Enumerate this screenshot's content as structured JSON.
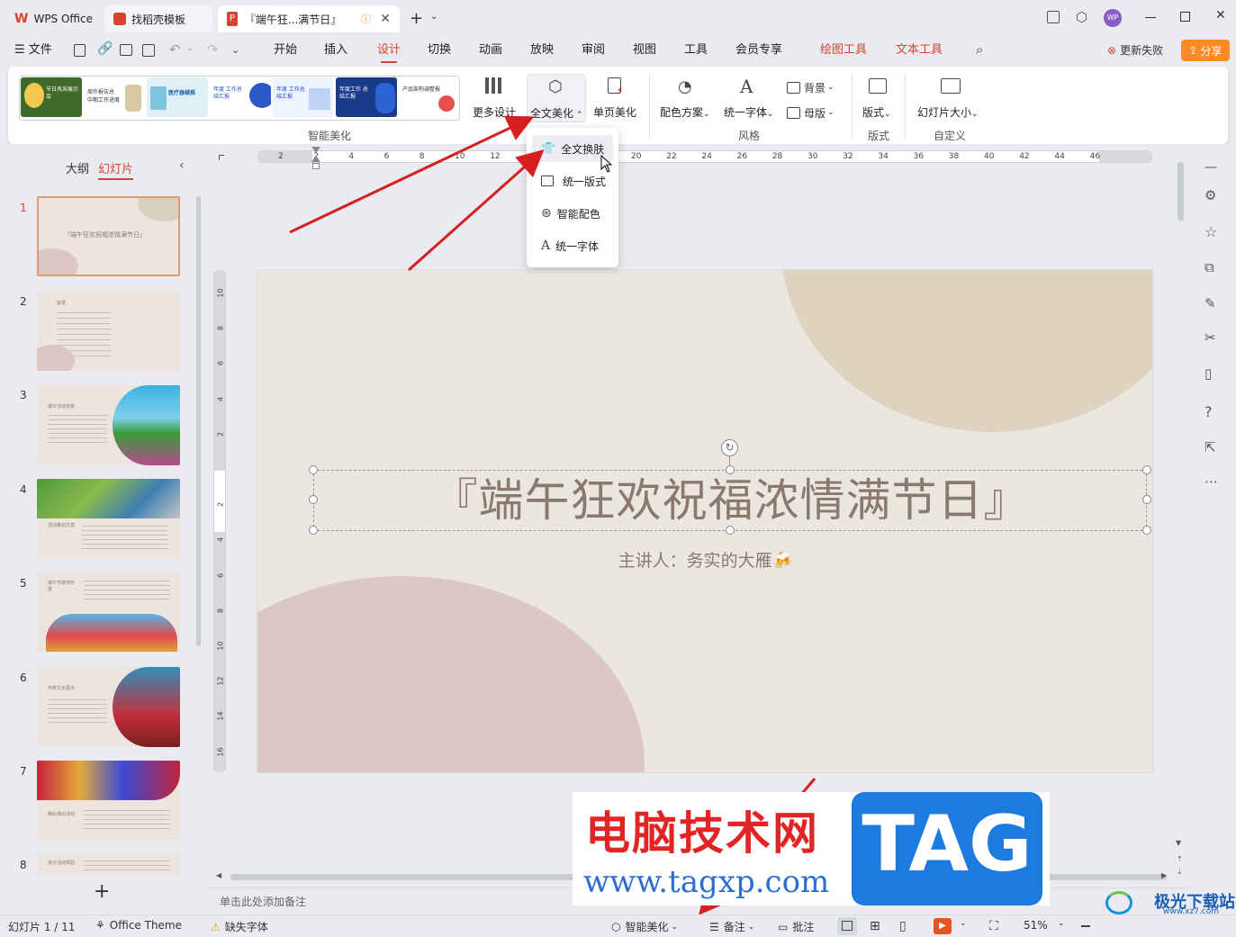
{
  "tabs": {
    "wps": "WPS Office",
    "template": "找稻壳模板",
    "doc": "『端午狂...满节日』",
    "avatar": "WP"
  },
  "menu": {
    "file": "文件",
    "items": [
      "开始",
      "插入",
      "设计",
      "切换",
      "动画",
      "放映",
      "审阅",
      "视图",
      "工具",
      "会员专享"
    ],
    "draw_tool": "绘图工具",
    "text_tool": "文本工具",
    "update_fail": "更新失败",
    "share": "分享"
  },
  "ribbon": {
    "more_design": "更多设计",
    "full_beautify": "全文美化",
    "single_beautify": "单页美化",
    "color_scheme": "配色方案",
    "unify_font": "统一字体",
    "background": "背景",
    "master": "母版",
    "layout": "版式",
    "slide_size": "幻灯片大小",
    "group_smart": "智能美化",
    "group_style": "风格",
    "group_layout": "版式",
    "group_custom": "自定义",
    "thumbs": [
      {
        "label": "节日风采展示会"
      },
      {
        "label": "周作报告总 中期工作进度"
      },
      {
        "label": "医疗器械推"
      },
      {
        "label": "年度 工作总结汇报"
      },
      {
        "label": "年度 工作总结汇报"
      },
      {
        "label": "年度工作 总结汇报"
      },
      {
        "label": "产品架构调整报"
      }
    ]
  },
  "dropdown": {
    "items": [
      "全文换肤",
      "统一版式",
      "智能配色",
      "统一字体"
    ]
  },
  "left_panel": {
    "outline": "大纲",
    "slides": "幻灯片",
    "thumbs": [
      {
        "num": "1",
        "title": "『端午狂欢祝福浓情满节日』"
      },
      {
        "num": "2",
        "title": "目录"
      },
      {
        "num": "3",
        "title": "端午活动背景"
      },
      {
        "num": "4",
        "title": "活动策划方案"
      },
      {
        "num": "5",
        "title": "端午节装饰布置"
      },
      {
        "num": "6",
        "title": "传统文化展示"
      },
      {
        "num": "7",
        "title": "精彩演出活动"
      },
      {
        "num": "8",
        "title": "亲子活动体验"
      }
    ],
    "add": "+"
  },
  "slide": {
    "title": "『端午狂欢祝福浓情满节日』",
    "subtitle": "主讲人：务实的大雁🍻"
  },
  "ruler": {
    "top": [
      "2",
      "2",
      "4",
      "6",
      "8",
      "10",
      "12",
      "14",
      "16",
      "18",
      "20",
      "22",
      "24",
      "26",
      "28",
      "30",
      "32",
      "34",
      "36",
      "38",
      "40",
      "42",
      "44",
      "46"
    ],
    "left": [
      "10",
      "8",
      "6",
      "4",
      "2",
      "",
      "2",
      "4",
      "6",
      "8",
      "10",
      "12",
      "14",
      "16"
    ]
  },
  "notes_placeholder": "单击此处添加备注",
  "watermark": {
    "text1": "电脑技术网",
    "tag": "TAG",
    "url": "www.tagxp.com",
    "logo": "极光下载站",
    "logo_url": "www.xz7.com"
  },
  "status": {
    "slide_count": "幻灯片 1 / 11",
    "theme": "Office Theme",
    "missing_font": "缺失字体",
    "smart": "智能美化",
    "notes": "备注",
    "comments": "批注",
    "zoom": "51%"
  },
  "colors": {
    "accent": "#d5442f",
    "share_bg": "#ff8a26",
    "slide_bg": "#ece6e1",
    "title_color": "#8a7a6e"
  }
}
